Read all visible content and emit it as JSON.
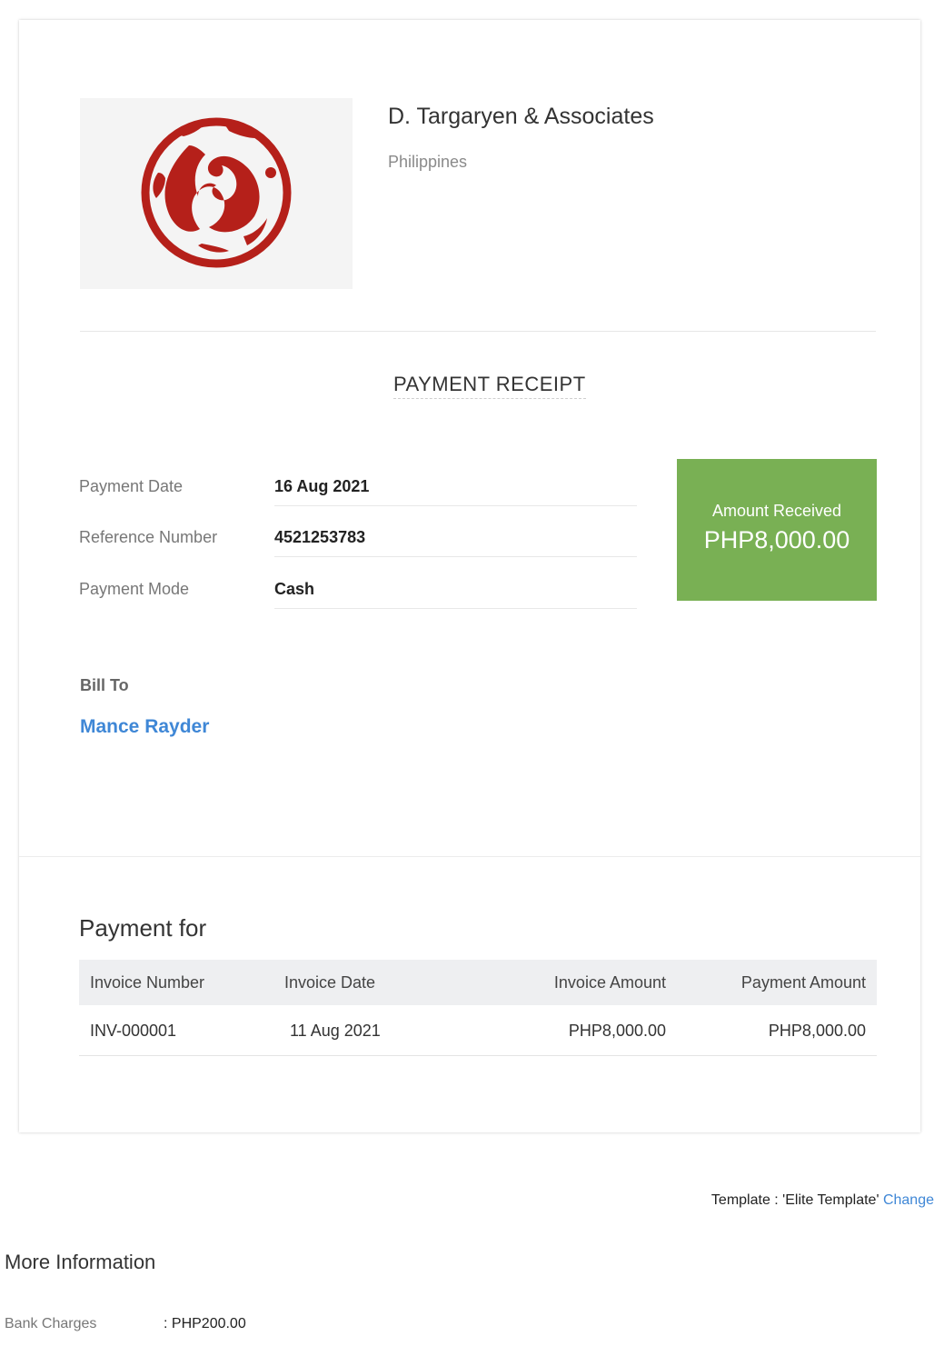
{
  "company": {
    "name": "D. Targaryen & Associates",
    "country": "Philippines",
    "logo_icon": "three-headed-dragon-sigil",
    "logo_color": "#b5201a"
  },
  "receipt": {
    "title": "PAYMENT RECEIPT",
    "details": [
      {
        "label": "Payment Date",
        "value": "16 Aug 2021"
      },
      {
        "label": "Reference Number",
        "value": "4521253783"
      },
      {
        "label": "Payment Mode",
        "value": "Cash"
      }
    ],
    "amount_label": "Amount Received",
    "amount_value": "PHP8,000.00",
    "amount_color": "#79b054"
  },
  "bill_to": {
    "label": "Bill To",
    "name": "Mance Rayder"
  },
  "payment_for": {
    "title": "Payment for",
    "columns": [
      "Invoice Number",
      "Invoice Date",
      "Invoice Amount",
      "Payment Amount"
    ],
    "rows": [
      [
        "INV-000001",
        "11 Aug 2021",
        "PHP8,000.00",
        "PHP8,000.00"
      ]
    ]
  },
  "template": {
    "text": "Template : 'Elite Template'",
    "change_label": "Change"
  },
  "more_info": {
    "title": "More Information",
    "bank_charges_label": "Bank Charges",
    "bank_charges_value": ": PHP200.00"
  },
  "link_color": "#3f87d6"
}
